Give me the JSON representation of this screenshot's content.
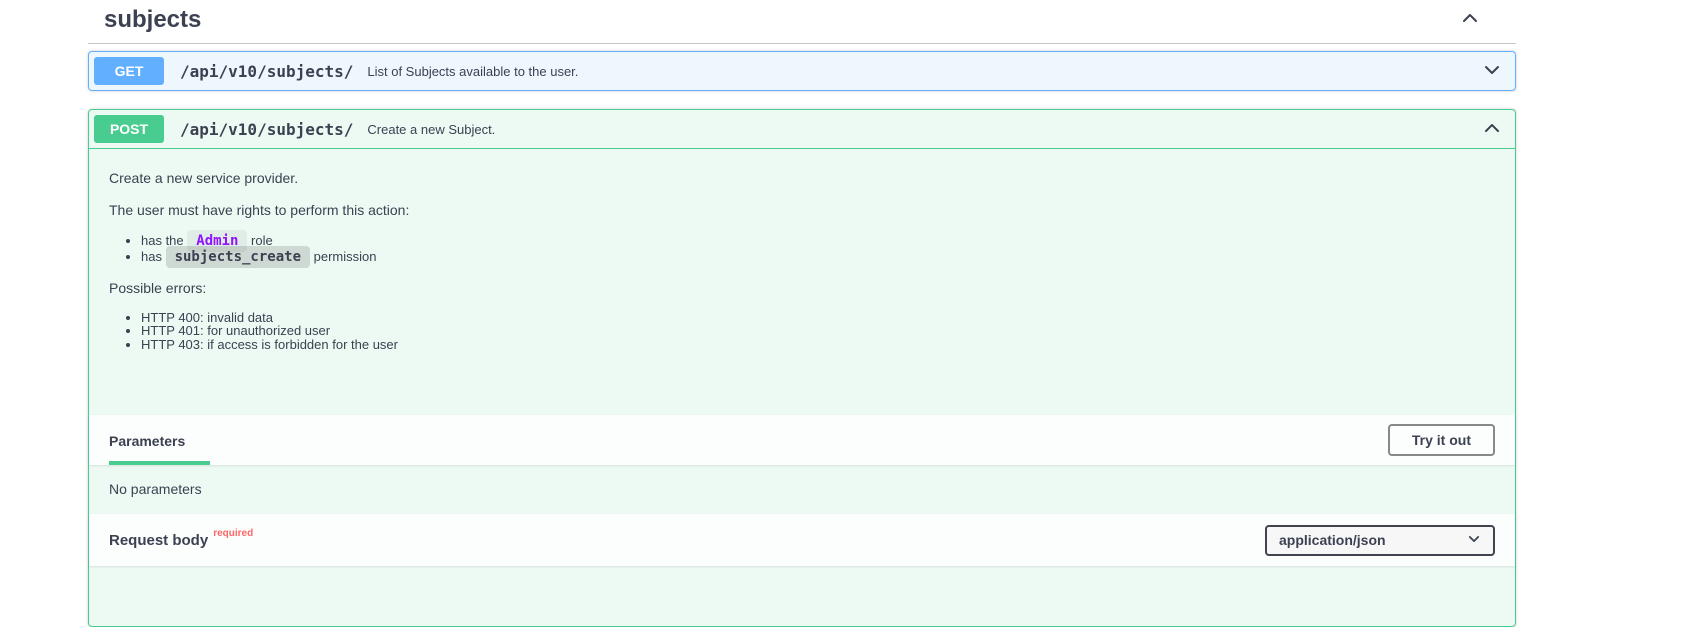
{
  "colors": {
    "get_accent": "#61affe",
    "get_background": "#eff7fe",
    "post_accent": "#49cc90",
    "post_background": "#edfaf3",
    "text": "#3b4151",
    "inline_code_purple": "#9012fe",
    "required_red": "#ff6666",
    "try_it_out_border": "#888888"
  },
  "tag_section": {
    "title": "subjects"
  },
  "endpoints": {
    "get": {
      "method": "GET",
      "path": "/api/v10/subjects/",
      "summary": "List of Subjects available to the user."
    },
    "post": {
      "method": "POST",
      "path": "/api/v10/subjects/",
      "summary": "Create a new Subject.",
      "description": {
        "intro": "Create a new service provider.",
        "rights_heading": "The user must have rights to perform this action:",
        "rights": [
          {
            "prefix": "has the ",
            "code": "Admin",
            "suffix": " role"
          },
          {
            "prefix": "has ",
            "code": "subjects_create",
            "suffix": " permission"
          }
        ],
        "errors_heading": "Possible errors:",
        "errors": [
          "HTTP 400: invalid data",
          "HTTP 401: for unauthorized user",
          "HTTP 403: if access is forbidden for the user"
        ]
      },
      "parameters_section": {
        "title": "Parameters",
        "try_it_out_label": "Try it out",
        "empty_message": "No parameters"
      },
      "request_body_section": {
        "title": "Request body",
        "required_label": "required",
        "content_type": "application/json"
      }
    }
  }
}
